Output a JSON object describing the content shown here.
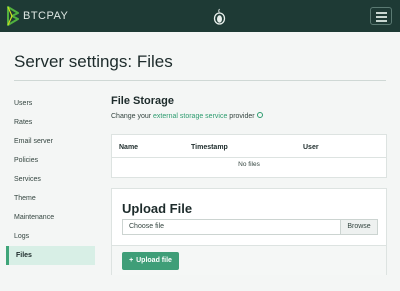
{
  "navbar": {
    "brand_text": "BTCPAY",
    "menu_icon": "hamburger-icon",
    "tor_icon": "tor-onion-icon",
    "bg_color": "#1e3a35"
  },
  "page": {
    "title": "Server settings: Files"
  },
  "sidebar": {
    "items": [
      {
        "label": "Users"
      },
      {
        "label": "Rates"
      },
      {
        "label": "Email server"
      },
      {
        "label": "Policies"
      },
      {
        "label": "Services"
      },
      {
        "label": "Theme"
      },
      {
        "label": "Maintenance"
      },
      {
        "label": "Logs"
      },
      {
        "label": "Files",
        "active": true
      }
    ],
    "active_color": "#3fa579"
  },
  "storage": {
    "title": "File Storage",
    "desc_prefix": "Change your ",
    "desc_link": "external storage service",
    "desc_suffix": " provider",
    "help_icon": "question-circle-icon"
  },
  "table": {
    "columns": [
      "Name",
      "Timestamp",
      "User"
    ],
    "empty_text": "No files"
  },
  "upload": {
    "title": "Upload File",
    "file_placeholder": "Choose file",
    "browse_label": "Browse",
    "button_label": "Upload file",
    "button_icon": "plus-icon",
    "button_color": "#3f9e78"
  }
}
